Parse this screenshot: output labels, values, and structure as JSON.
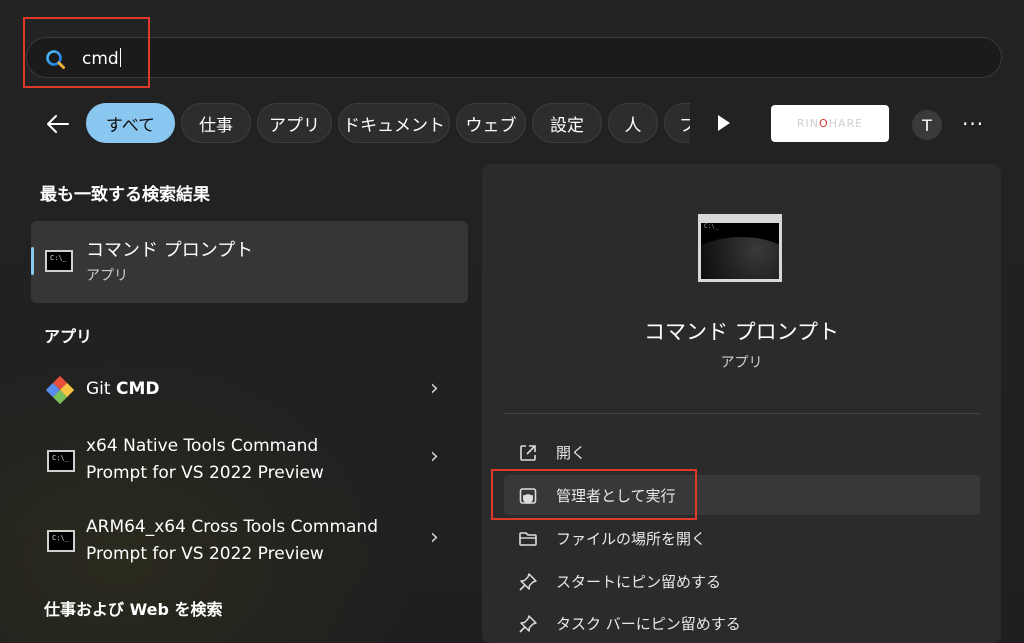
{
  "search": {
    "query": "cmd"
  },
  "filters": {
    "items": [
      {
        "label": "すべて",
        "active": true
      },
      {
        "label": "仕事"
      },
      {
        "label": "アプリ"
      },
      {
        "label": "ドキュメント"
      },
      {
        "label": "ウェブ"
      },
      {
        "label": "設定"
      },
      {
        "label": "人"
      },
      {
        "label": "フ"
      }
    ]
  },
  "account": {
    "avatar_letter": "T",
    "more": "···"
  },
  "brand": {
    "text_a": "RIN",
    "text_o": "O",
    "text_b": "HARE"
  },
  "best_match": {
    "title": "最も一致する検索結果",
    "name": "コマンド プロンプト",
    "type": "アプリ"
  },
  "apps": {
    "title": "アプリ",
    "items": [
      {
        "line1_a": "Git ",
        "line1_b": "CMD",
        "line2": ""
      },
      {
        "line1": "x64 Native Tools Command",
        "line2": "Prompt for VS 2022 Preview"
      },
      {
        "line1": "ARM64_x64 Cross Tools Command",
        "line2": "Prompt for VS 2022 Preview"
      }
    ]
  },
  "web_search": {
    "title": "仕事および Web を検索"
  },
  "detail": {
    "name": "コマンド プロンプト",
    "type": "アプリ",
    "actions": [
      {
        "label": "開く",
        "icon": "open-icon"
      },
      {
        "label": "管理者として実行",
        "icon": "shield-icon"
      },
      {
        "label": "ファイルの場所を開く",
        "icon": "folder-icon"
      },
      {
        "label": "スタートにピン留めする",
        "icon": "pin-icon"
      },
      {
        "label": "タスク バーにピン留めする",
        "icon": "pin-icon"
      }
    ]
  },
  "colors": {
    "accent": "#8ac7f0",
    "highlight": "#e0392b",
    "panel": "#2b2b2b"
  }
}
